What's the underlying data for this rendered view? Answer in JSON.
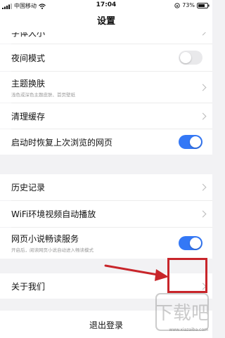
{
  "status_bar": {
    "carrier": "中国移动",
    "time": "17:04",
    "battery": "73%",
    "icons": [
      "signal-icon",
      "wifi-icon",
      "orientation-lock-icon",
      "battery-icon"
    ]
  },
  "header": {
    "title": "设置"
  },
  "settings": {
    "font_size": {
      "label": "字体大小"
    },
    "night_mode": {
      "label": "夜间模式",
      "enabled": false
    },
    "theme": {
      "label": "主题换肤",
      "subtitle": "浅色或深色主题皮肤、首页壁纸"
    },
    "clear_cache": {
      "label": "清理缓存"
    },
    "restore_pages": {
      "label": "启动时恢复上次浏览的网页",
      "enabled": true
    },
    "history": {
      "label": "历史记录"
    },
    "wifi_autoplay": {
      "label": "WiFi环境视频自动播放"
    },
    "novel_mode": {
      "label": "网页小说畅读服务",
      "subtitle": "开启后，阅读网页小说自动进入畅读模式",
      "enabled": true
    },
    "about": {
      "label": "关于我们"
    },
    "logout": {
      "label": "退出登录"
    }
  },
  "colors": {
    "toggle_on": "#3478f6",
    "highlight": "#c8252a",
    "background": "#f2f2f4"
  },
  "watermark": {
    "text": "下载吧",
    "url": "www.xiazaiba.com"
  }
}
